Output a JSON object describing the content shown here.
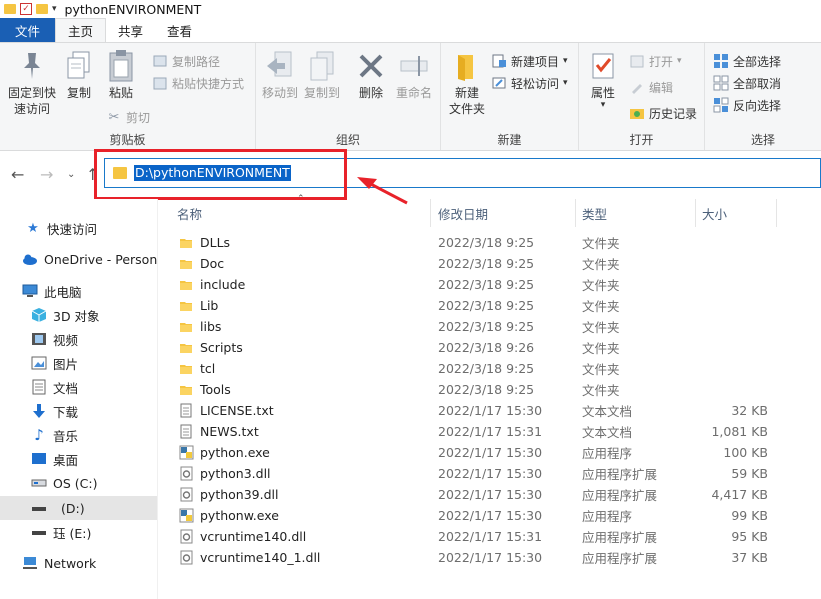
{
  "window": {
    "title": "pythonENVIRONMENT"
  },
  "tabs": [
    {
      "label": "文件"
    },
    {
      "label": "主页"
    },
    {
      "label": "共享"
    },
    {
      "label": "查看"
    }
  ],
  "ribbon": {
    "clipboard": {
      "label": "剪贴板",
      "pin": "固定到快\n速访问",
      "pin_l1": "固定到快",
      "pin_l2": "速访问",
      "copy": "复制",
      "paste": "粘贴",
      "copy_path": "复制路径",
      "paste_shortcut": "粘贴快捷方式",
      "cut": "剪切"
    },
    "organize": {
      "label": "组织",
      "move_to": "移动到",
      "copy_to": "复制到",
      "delete": "删除",
      "rename": "重命名"
    },
    "new": {
      "label": "新建",
      "new_folder_l1": "新建",
      "new_folder_l2": "文件夹",
      "new_item": "新建项目",
      "easy_access": "轻松访问"
    },
    "open": {
      "label": "打开",
      "properties": "属性",
      "open": "打开",
      "edit": "编辑",
      "history": "历史记录"
    },
    "select": {
      "label": "选择",
      "select_all": "全部选择",
      "select_none": "全部取消",
      "invert": "反向选择"
    }
  },
  "address": {
    "path": "D:\\pythonENVIRONMENT"
  },
  "sidebar": {
    "items": [
      {
        "label": "快速访问",
        "icon": "star-icon"
      },
      {
        "label": "OneDrive - Persona",
        "icon": "cloud-icon"
      },
      {
        "label": "此电脑",
        "icon": "computer-icon"
      },
      {
        "label": "3D 对象",
        "icon": "cube-icon"
      },
      {
        "label": "视频",
        "icon": "video-icon"
      },
      {
        "label": "图片",
        "icon": "picture-icon"
      },
      {
        "label": "文档",
        "icon": "document-icon"
      },
      {
        "label": "下载",
        "icon": "download-icon"
      },
      {
        "label": "音乐",
        "icon": "music-icon"
      },
      {
        "label": "桌面",
        "icon": "desktop-icon"
      },
      {
        "label": "OS (C:)",
        "icon": "drive-icon"
      },
      {
        "label": "(D:)",
        "icon": "drive-icon"
      },
      {
        "label": "珏 (E:)",
        "icon": "drive-icon"
      },
      {
        "label": "Network",
        "icon": "network-icon"
      }
    ]
  },
  "columns": {
    "name": "名称",
    "date": "修改日期",
    "type": "类型",
    "size": "大小"
  },
  "files": [
    {
      "name": "DLLs",
      "date": "2022/3/18 9:25",
      "type": "文件夹",
      "size": "",
      "icon": "folder"
    },
    {
      "name": "Doc",
      "date": "2022/3/18 9:25",
      "type": "文件夹",
      "size": "",
      "icon": "folder"
    },
    {
      "name": "include",
      "date": "2022/3/18 9:25",
      "type": "文件夹",
      "size": "",
      "icon": "folder"
    },
    {
      "name": "Lib",
      "date": "2022/3/18 9:25",
      "type": "文件夹",
      "size": "",
      "icon": "folder"
    },
    {
      "name": "libs",
      "date": "2022/3/18 9:25",
      "type": "文件夹",
      "size": "",
      "icon": "folder"
    },
    {
      "name": "Scripts",
      "date": "2022/3/18 9:26",
      "type": "文件夹",
      "size": "",
      "icon": "folder"
    },
    {
      "name": "tcl",
      "date": "2022/3/18 9:25",
      "type": "文件夹",
      "size": "",
      "icon": "folder"
    },
    {
      "name": "Tools",
      "date": "2022/3/18 9:25",
      "type": "文件夹",
      "size": "",
      "icon": "folder"
    },
    {
      "name": "LICENSE.txt",
      "date": "2022/1/17 15:30",
      "type": "文本文档",
      "size": "32 KB",
      "icon": "text"
    },
    {
      "name": "NEWS.txt",
      "date": "2022/1/17 15:31",
      "type": "文本文档",
      "size": "1,081 KB",
      "icon": "text"
    },
    {
      "name": "python.exe",
      "date": "2022/1/17 15:30",
      "type": "应用程序",
      "size": "100 KB",
      "icon": "python"
    },
    {
      "name": "python3.dll",
      "date": "2022/1/17 15:30",
      "type": "应用程序扩展",
      "size": "59 KB",
      "icon": "dll"
    },
    {
      "name": "python39.dll",
      "date": "2022/1/17 15:30",
      "type": "应用程序扩展",
      "size": "4,417 KB",
      "icon": "dll"
    },
    {
      "name": "pythonw.exe",
      "date": "2022/1/17 15:30",
      "type": "应用程序",
      "size": "99 KB",
      "icon": "python"
    },
    {
      "name": "vcruntime140.dll",
      "date": "2022/1/17 15:31",
      "type": "应用程序扩展",
      "size": "95 KB",
      "icon": "dll"
    },
    {
      "name": "vcruntime140_1.dll",
      "date": "2022/1/17 15:30",
      "type": "应用程序扩展",
      "size": "37 KB",
      "icon": "dll"
    }
  ],
  "colors": {
    "accent": "#1a5fb4",
    "selection": "#0a64c8",
    "highlight_box": "#e8222a",
    "folder": "#f5c542"
  }
}
